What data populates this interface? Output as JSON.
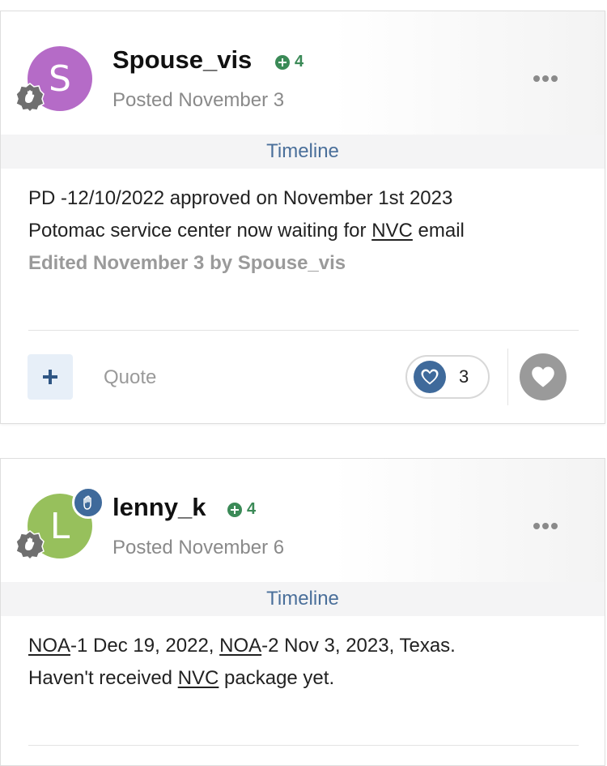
{
  "colors": {
    "avatar_s": "#b56bc7",
    "avatar_l": "#97c05c",
    "accent_blue": "#3f6a9b",
    "reputation_green": "#3b8a57",
    "timeline_text": "#4a6f9a"
  },
  "posts": [
    {
      "avatar_letter": "S",
      "username": "Spouse_vis",
      "reputation": "4",
      "posted": "Posted November 3",
      "timeline_label": "Timeline",
      "content_line1": "PD -12/10/2022 approved on November 1st 2023",
      "content_line2_pre": "Potomac service center now waiting for ",
      "content_line2_link": "NVC",
      "content_line2_post": " email",
      "edited": "Edited November 3 by Spouse_vis",
      "quote_label": "Quote",
      "like_count": "3",
      "icons": {
        "rank": "rank-badge-icon",
        "menu": "more-options-icon",
        "add": "plus-icon",
        "like": "heart-icon",
        "react": "heart-icon"
      }
    },
    {
      "avatar_letter": "L",
      "username": "lenny_k",
      "reputation": "4",
      "posted": "Posted November 6",
      "timeline_label": "Timeline",
      "content_link1": "NOA",
      "content_text1": "-1 Dec 19, 2022, ",
      "content_link2": "NOA",
      "content_text2": "-2 Nov 3, 2023, Texas.",
      "content_line2_pre": "Haven't received ",
      "content_line2_link": "NVC",
      "content_line2_post": " package yet.",
      "icons": {
        "rank": "rank-badge-icon",
        "status": "raised-hand-icon",
        "menu": "more-options-icon"
      }
    }
  ]
}
